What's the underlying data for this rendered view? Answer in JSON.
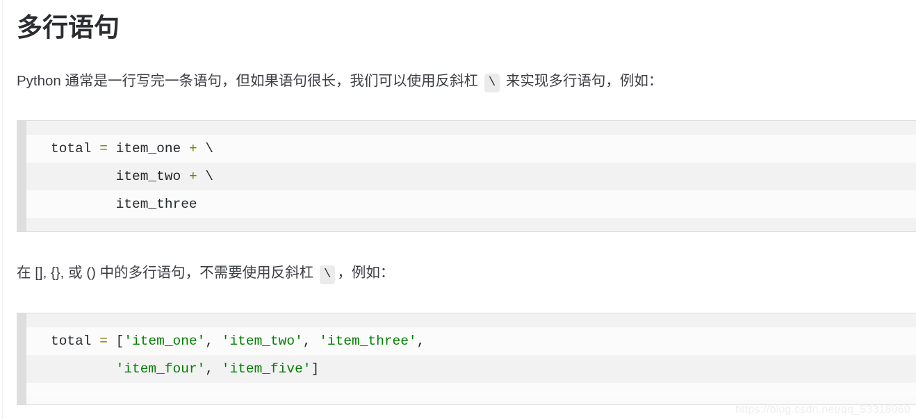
{
  "page": {
    "background": "#ffffff",
    "text_color": "#3b3e44",
    "heading_color": "#2b2d30"
  },
  "heading": {
    "text": "多行语句"
  },
  "paragraphs": [
    {
      "id": "para-backslash",
      "before": "Python 通常是一行写完一条语句，但如果语句很长，我们可以使用反斜杠 ",
      "inline_code": "\\",
      "after": " 来实现多行语句，例如："
    },
    {
      "id": "para-brackets",
      "before": "在 [], {}, 或 () 中的多行语句，不需要使用反斜杠 ",
      "inline_code": "\\",
      "after": "，例如："
    }
  ],
  "code_blocks": [
    {
      "id": "code-block-backslash",
      "language": "python",
      "background": "#fafafa",
      "stripe_color": "#f2f2f2",
      "gutter_color": "#dedede",
      "lines": [
        {
          "tokens": [
            {
              "t": "total ",
              "c": "txt"
            },
            {
              "t": "=",
              "c": "op"
            },
            {
              "t": " item_one ",
              "c": "txt"
            },
            {
              "t": "+",
              "c": "op"
            },
            {
              "t": " \\",
              "c": "txt"
            }
          ]
        },
        {
          "tokens": [
            {
              "t": "        item_two ",
              "c": "txt"
            },
            {
              "t": "+",
              "c": "op"
            },
            {
              "t": " \\",
              "c": "txt"
            }
          ]
        },
        {
          "tokens": [
            {
              "t": "        item_three",
              "c": "txt"
            }
          ]
        }
      ]
    },
    {
      "id": "code-block-list",
      "language": "python",
      "background": "#fafafa",
      "stripe_color": "#f2f2f2",
      "gutter_color": "#dedede",
      "lines": [
        {
          "tokens": [
            {
              "t": "total ",
              "c": "txt"
            },
            {
              "t": "=",
              "c": "op"
            },
            {
              "t": " [",
              "c": "pun"
            },
            {
              "t": "'item_one'",
              "c": "str"
            },
            {
              "t": ", ",
              "c": "pun"
            },
            {
              "t": "'item_two'",
              "c": "str"
            },
            {
              "t": ", ",
              "c": "pun"
            },
            {
              "t": "'item_three'",
              "c": "str"
            },
            {
              "t": ",",
              "c": "pun"
            }
          ]
        },
        {
          "tokens": [
            {
              "t": "        ",
              "c": "txt"
            },
            {
              "t": "'item_four'",
              "c": "str"
            },
            {
              "t": ", ",
              "c": "pun"
            },
            {
              "t": "'item_five'",
              "c": "str"
            },
            {
              "t": "]",
              "c": "pun"
            }
          ]
        }
      ]
    }
  ],
  "watermark": {
    "text": "https://blog.csdn.net/qq_53318060"
  },
  "colors": {
    "operator": "#7a7a00",
    "string": "#008000",
    "plain": "#24292e",
    "inline_code_bg": "#ebebeb"
  }
}
